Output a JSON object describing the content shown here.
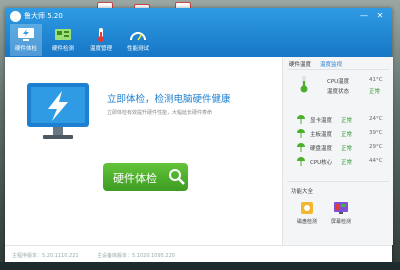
{
  "app": {
    "title": "鲁大师 5.20",
    "window_controls": [
      "—",
      "✕"
    ]
  },
  "tabs": [
    {
      "label": "硬件体检",
      "active": true
    },
    {
      "label": "硬件检测",
      "active": false
    },
    {
      "label": "温度管理",
      "active": false
    },
    {
      "label": "性能测试",
      "active": false
    }
  ],
  "hero": {
    "title": "立即体检，检测电脑硬件健康",
    "subtitle": "立即体检有效提升硬件性能，大幅延长硬件寿命",
    "button_label": "硬件体检"
  },
  "side": {
    "tab_temp": "硬件温度",
    "tab_monitor": "温度监视",
    "cpu_temp_label": "CPU温度",
    "cpu_temp_value": "41°C",
    "cpu_status_label": "温度状态",
    "cpu_status_value": "正常",
    "temps": [
      {
        "name": "显卡温度",
        "status": "正常",
        "value": "24°C"
      },
      {
        "name": "主板温度",
        "status": "正常",
        "value": "39°C"
      },
      {
        "name": "硬盘温度",
        "status": "正常",
        "value": "29°C"
      },
      {
        "name": "CPU核心",
        "status": "正常",
        "value": "44°C"
      }
    ],
    "functions_title": "功能大全",
    "functions": [
      {
        "label": "磁盘检测"
      },
      {
        "label": "屏幕检测"
      }
    ]
  },
  "status_bar": {
    "main_version": "主程序版本：5.20.1110.221",
    "db_version": "主设备库版本：5.1020.1095.220"
  },
  "colors": {
    "topbar": "#1d83d4",
    "accent_green": "#4caf2e",
    "title_blue": "#1d7fd0"
  }
}
